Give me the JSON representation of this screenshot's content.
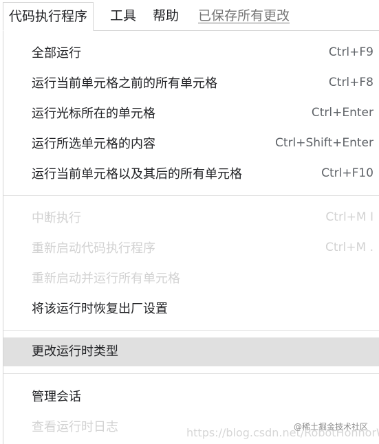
{
  "menubar": {
    "active_menu": "代码执行程序",
    "tools": "工具",
    "help": "帮助",
    "save_status": "已保存所有更改"
  },
  "dropdown": {
    "items": [
      {
        "label": "全部运行",
        "shortcut": "Ctrl+F9",
        "enabled": true
      },
      {
        "label": "运行当前单元格之前的所有单元格",
        "shortcut": "Ctrl+F8",
        "enabled": true
      },
      {
        "label": "运行光标所在的单元格",
        "shortcut": "Ctrl+Enter",
        "enabled": true
      },
      {
        "label": "运行所选单元格的内容",
        "shortcut": "Ctrl+Shift+Enter",
        "enabled": true
      },
      {
        "label": "运行当前单元格以及其后的所有单元格",
        "shortcut": "Ctrl+F10",
        "enabled": true
      },
      {
        "label": "中断执行",
        "shortcut": "Ctrl+M I",
        "enabled": false
      },
      {
        "label": "重新启动代码执行程序",
        "shortcut": "Ctrl+M .",
        "enabled": false
      },
      {
        "label": "重新启动并运行所有单元格",
        "shortcut": "",
        "enabled": false
      },
      {
        "label": "将该运行时恢复出厂设置",
        "shortcut": "",
        "enabled": true
      },
      {
        "label": "更改运行时类型",
        "shortcut": "",
        "enabled": true,
        "highlighted": true
      },
      {
        "label": "管理会话",
        "shortcut": "",
        "enabled": true
      },
      {
        "label": "查看运行时日志",
        "shortcut": "",
        "enabled": false
      }
    ]
  },
  "watermarks": {
    "site": "@稀土掘金技术社区",
    "url": "https://blog.csdn.net/RobotHonnorWar"
  }
}
